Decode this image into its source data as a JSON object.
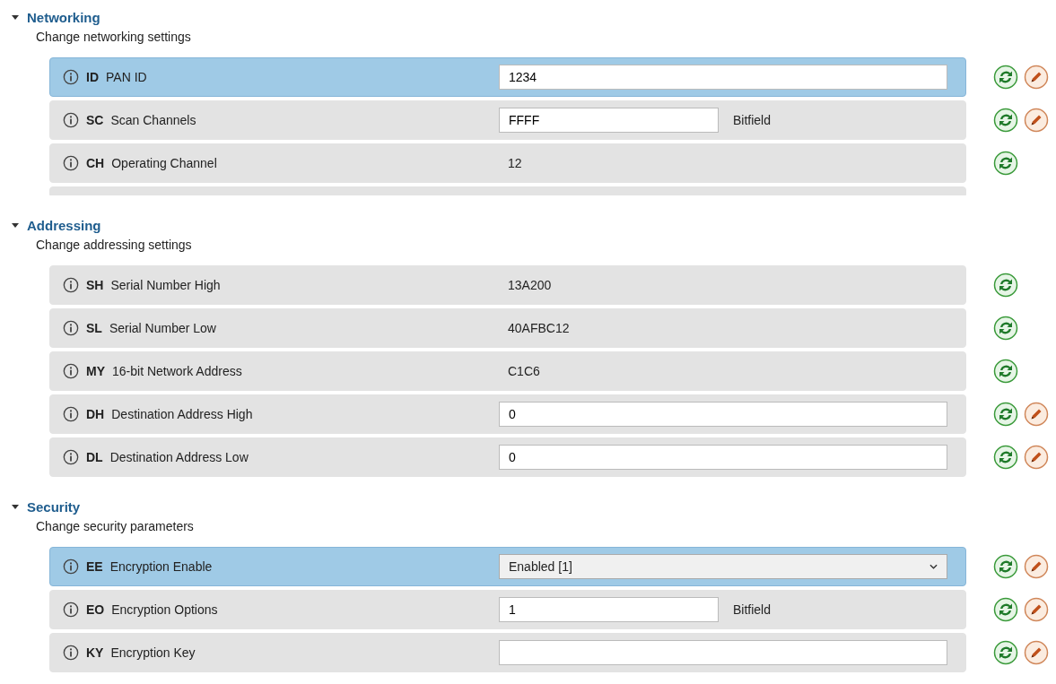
{
  "sections": [
    {
      "title": "Networking",
      "description": "Change networking settings",
      "expanded": true,
      "clipped": true,
      "rows": [
        {
          "code": "ID",
          "name": "PAN ID",
          "kind": "input",
          "value": "1234",
          "selected": true,
          "writable": true
        },
        {
          "code": "SC",
          "name": "Scan Channels",
          "kind": "input_unit",
          "value": "FFFF",
          "unit": "Bitfield",
          "selected": false,
          "writable": true
        },
        {
          "code": "CH",
          "name": "Operating Channel",
          "kind": "text",
          "value": "12",
          "selected": false,
          "writable": false
        }
      ]
    },
    {
      "title": "Addressing",
      "description": "Change addressing settings",
      "expanded": true,
      "rows": [
        {
          "code": "SH",
          "name": "Serial Number High",
          "kind": "text",
          "value": "13A200",
          "selected": false,
          "writable": false
        },
        {
          "code": "SL",
          "name": "Serial Number Low",
          "kind": "text",
          "value": "40AFBC12",
          "selected": false,
          "writable": false
        },
        {
          "code": "MY",
          "name": "16-bit Network Address",
          "kind": "text",
          "value": "C1C6",
          "selected": false,
          "writable": false
        },
        {
          "code": "DH",
          "name": "Destination Address High",
          "kind": "input",
          "value": "0",
          "selected": false,
          "writable": true
        },
        {
          "code": "DL",
          "name": "Destination Address Low",
          "kind": "input",
          "value": "0",
          "selected": false,
          "writable": true
        }
      ]
    },
    {
      "title": "Security",
      "description": "Change security parameters",
      "expanded": true,
      "rows": [
        {
          "code": "EE",
          "name": "Encryption Enable",
          "kind": "select",
          "value": "Enabled [1]",
          "selected": true,
          "writable": true
        },
        {
          "code": "EO",
          "name": "Encryption Options",
          "kind": "input_unit",
          "value": "1",
          "unit": "Bitfield",
          "selected": false,
          "writable": true
        },
        {
          "code": "KY",
          "name": "Encryption Key",
          "kind": "input",
          "selected": false,
          "writable": true
        }
      ]
    }
  ]
}
